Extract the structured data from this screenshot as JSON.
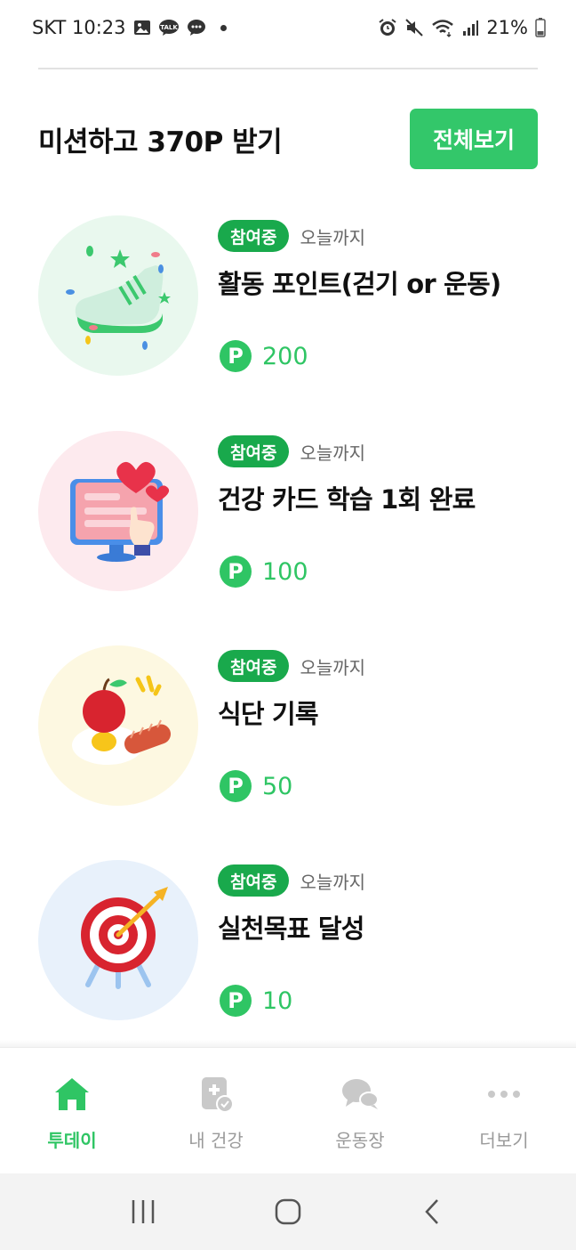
{
  "status_bar": {
    "carrier_time": "SKT 10:23",
    "battery": "21%",
    "icons": [
      "gallery-icon",
      "kakaotalk-icon",
      "chat-icon",
      "alarm-icon",
      "mute-icon",
      "wifi-icon",
      "signal-icon",
      "battery-icon"
    ]
  },
  "header": {
    "title": "미션하고 370P 받기",
    "view_all_label": "전체보기"
  },
  "missions": [
    {
      "badge": "참여중",
      "deadline": "오늘까지",
      "title": "활동 포인트(걷기 or 운동)",
      "points": "200",
      "point_symbol": "P",
      "icon": "sneaker-icon",
      "bg_color": "#e9f8ee"
    },
    {
      "badge": "참여중",
      "deadline": "오늘까지",
      "title": "건강 카드 학습 1회 완료",
      "points": "100",
      "point_symbol": "P",
      "icon": "monitor-heart-icon",
      "bg_color": "#fdeaee"
    },
    {
      "badge": "참여중",
      "deadline": "오늘까지",
      "title": "식단 기록",
      "points": "50",
      "point_symbol": "P",
      "icon": "meal-icon",
      "bg_color": "#fdf8e1"
    },
    {
      "badge": "참여중",
      "deadline": "오늘까지",
      "title": "실천목표 달성",
      "points": "10",
      "point_symbol": "P",
      "icon": "target-icon",
      "bg_color": "#e8f1fb"
    }
  ],
  "bottom_nav": {
    "items": [
      {
        "label": "투데이",
        "icon": "home-icon",
        "active": true
      },
      {
        "label": "내 건강",
        "icon": "health-card-icon",
        "active": false
      },
      {
        "label": "운동장",
        "icon": "chat-bubbles-icon",
        "active": false
      },
      {
        "label": "더보기",
        "icon": "more-icon",
        "active": false
      }
    ]
  },
  "system_nav": {
    "icons": [
      "recent-apps-icon",
      "home-button-icon",
      "back-icon"
    ]
  },
  "colors": {
    "accent": "#33c76a",
    "badge": "#19a94c",
    "points": "#2fc564"
  }
}
